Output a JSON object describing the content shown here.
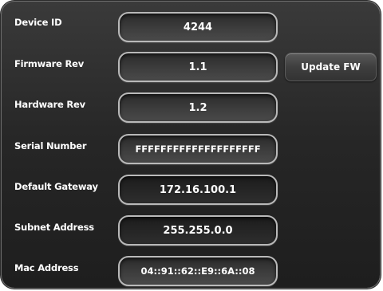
{
  "rows": [
    {
      "label": "Device ID",
      "value": "4244"
    },
    {
      "label": "Firmware Rev",
      "value": "1.1"
    },
    {
      "label": "Hardware Rev",
      "value": "1.2"
    },
    {
      "label": "Serial Number",
      "value": "FFFFFFFFFFFFFFFFFFFF"
    },
    {
      "label": "Default Gateway",
      "value": "172.16.100.1"
    },
    {
      "label": "Subnet Address",
      "value": "255.255.0.0"
    },
    {
      "label": "Mac Address",
      "value": "04::91::62::E9::6A::08"
    }
  ],
  "update_button": {
    "label": "Update FW"
  }
}
